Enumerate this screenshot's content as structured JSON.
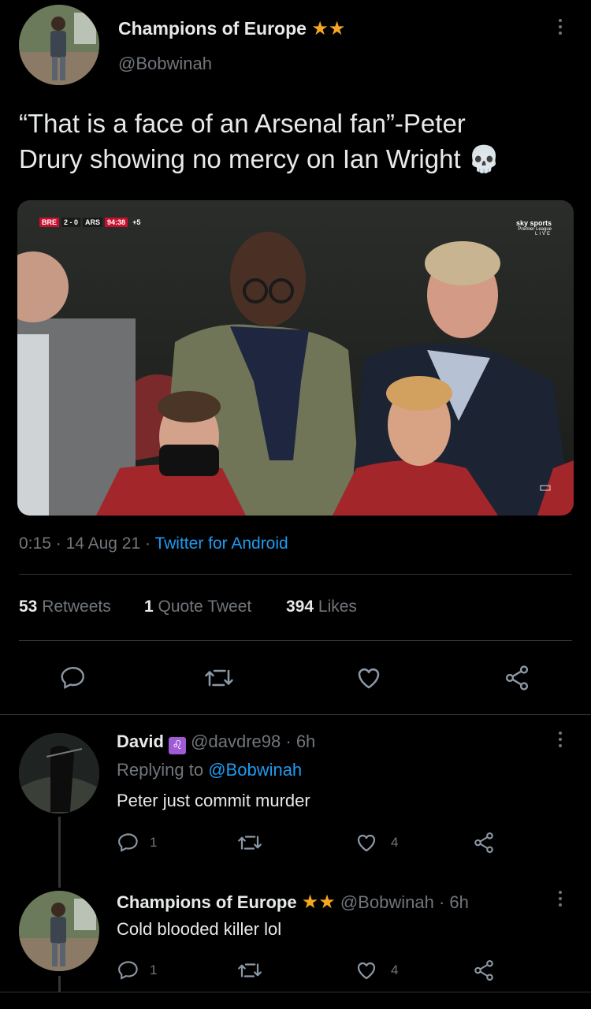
{
  "tweet": {
    "author_name": "Champions of Europe",
    "author_handle": "@Bobwinah",
    "text_line1": "“That is a face of an Arsenal fan”-Peter",
    "text_line2": "Drury showing no mercy on Ian Wright",
    "emoji": "💀",
    "media": {
      "score_home": "BRE",
      "score": "2 - 0",
      "score_away": "ARS",
      "clock": "94:38",
      "added": "+5",
      "broadcaster": "sky sports",
      "competition": "Premier League",
      "live": "LIVE"
    },
    "time": "0:15",
    "date": "14 Aug 21",
    "source": "Twitter for Android",
    "retweets_count": "53",
    "retweets_label": "Retweets",
    "quotes_count": "1",
    "quotes_label": "Quote Tweet",
    "likes_count": "394",
    "likes_label": "Likes"
  },
  "replies": [
    {
      "name": "David",
      "handle": "@davdre98",
      "time": "· 6h",
      "replying_prefix": "Replying to",
      "replying_to": "@Bobwinah",
      "text": "Peter just commit murder",
      "reply_count": "1",
      "like_count": "4"
    },
    {
      "name": "Champions of Europe",
      "handle": "@Bobwinah",
      "time": "· 6h",
      "text": "Cold blooded killer lol",
      "reply_count": "1",
      "like_count": "4"
    }
  ],
  "colors": {
    "background": "#000000",
    "text": "#e7e9ea",
    "muted": "#71767b",
    "link": "#1d9bf0",
    "star": "#f5a623",
    "zodiac": "#a05ad6"
  }
}
